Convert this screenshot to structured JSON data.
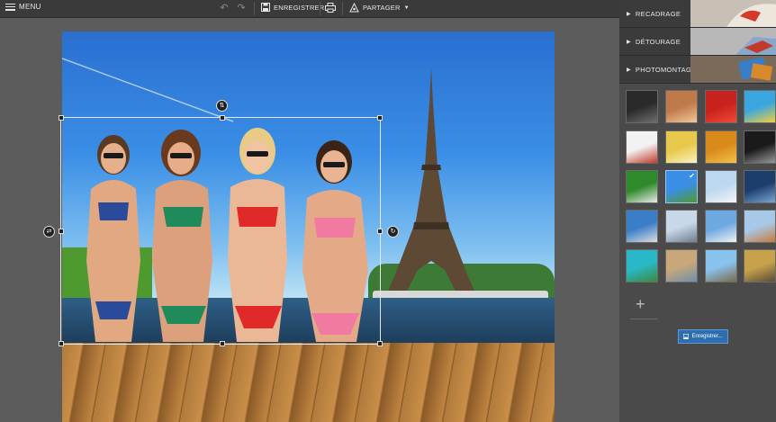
{
  "toolbar": {
    "menu_label": "MENU",
    "save_label": "ENREGISTRER",
    "share_label": "PARTAGER"
  },
  "sidebar": {
    "sections": [
      {
        "label": "RECADRAGE",
        "expanded": false
      },
      {
        "label": "DÉTOURAGE",
        "expanded": false
      },
      {
        "label": "PHOTOMONTAGE",
        "expanded": true
      }
    ],
    "save_button_label": "Enregistrer..."
  },
  "colors": {
    "accent": "#2d6fae",
    "panel": "#4a4a4a",
    "toolbar": "#3a3a3a"
  },
  "thumbnails": [
    {
      "name": "moon-dark",
      "c1": "#2a2a2a",
      "c2": "#6e6e6e"
    },
    {
      "name": "sunset-heart",
      "c1": "#c07a4a",
      "c2": "#f2c89a"
    },
    {
      "name": "red-heart",
      "c1": "#c8221c",
      "c2": "#f04a3a"
    },
    {
      "name": "comic-bubbles",
      "c1": "#3aa6e0",
      "c2": "#f2d13a"
    },
    {
      "name": "white-splash",
      "c1": "#f2f2f2",
      "c2": "#c03a2a"
    },
    {
      "name": "yellow-minion",
      "c1": "#e8c84a",
      "c2": "#f8f2c2"
    },
    {
      "name": "golden-glow",
      "c1": "#d98a1a",
      "c2": "#f4c24a"
    },
    {
      "name": "dark-fire",
      "c1": "#1a1a1a",
      "c2": "#9a9a9a"
    },
    {
      "name": "cow-meadow",
      "c1": "#2e8a2a",
      "c2": "#eaeaea"
    },
    {
      "name": "eiffel-selected",
      "c1": "#3a8ee6",
      "c2": "#4f9a2e",
      "selected": true
    },
    {
      "name": "snowman",
      "c1": "#bcd8f0",
      "c2": "#f4f4f4"
    },
    {
      "name": "city-night",
      "c1": "#1d3e6c",
      "c2": "#7aa6d8"
    },
    {
      "name": "harbor",
      "c1": "#3a7ec8",
      "c2": "#dcdcdc"
    },
    {
      "name": "winter-trees",
      "c1": "#c8d8e8",
      "c2": "#6e7e8e"
    },
    {
      "name": "snow-mountains",
      "c1": "#6ea8e0",
      "c2": "#f2f2f2"
    },
    {
      "name": "city-skyline",
      "c1": "#a8c8e8",
      "c2": "#c87a3a"
    },
    {
      "name": "tropical-island",
      "c1": "#2ab8c8",
      "c2": "#3a8a3a"
    },
    {
      "name": "venice",
      "c1": "#c8a87a",
      "c2": "#6e8eae"
    },
    {
      "name": "eiffel-day",
      "c1": "#8ac2ee",
      "c2": "#7a6a4a"
    },
    {
      "name": "ny-street",
      "c1": "#c8a24a",
      "c2": "#5a4a3a"
    }
  ]
}
